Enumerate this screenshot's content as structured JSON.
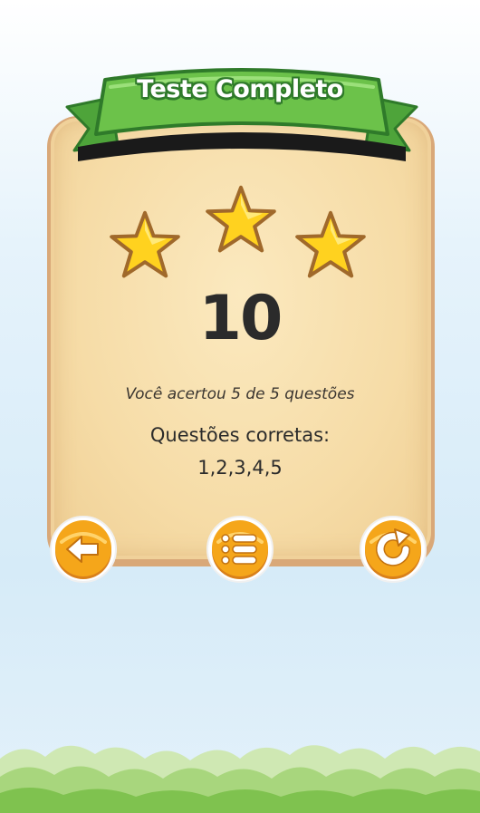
{
  "dialog": {
    "title": "Teste Completo",
    "stars_earned": 3,
    "stars_total": 3,
    "score": "10",
    "summary": "Você acertou 5 de 5 questões",
    "correct_label": "Questões corretas:",
    "correct_list": "1,2,3,4,5"
  },
  "buttons": [
    {
      "name": "back-button",
      "icon": "arrow-left-icon"
    },
    {
      "name": "menu-button",
      "icon": "list-icon"
    },
    {
      "name": "retry-button",
      "icon": "refresh-icon"
    }
  ],
  "colors": {
    "banner_green": "#6cc24a",
    "banner_outline": "#2f7a2a",
    "star_fill": "#ffd21f",
    "star_outline": "#a0692b",
    "button_orange": "#f5a61a",
    "board": "#f6dca7"
  }
}
